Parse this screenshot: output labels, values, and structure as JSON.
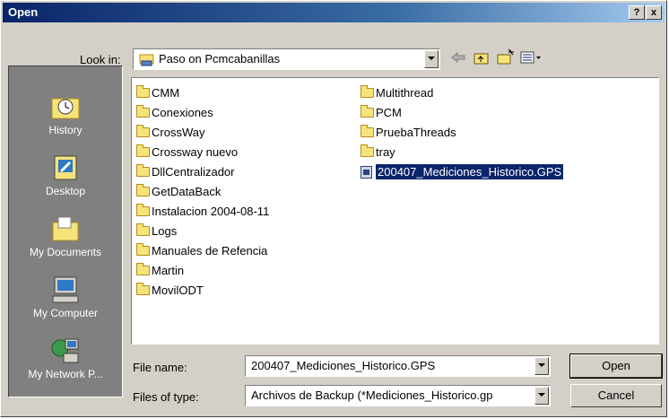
{
  "window": {
    "title": "Open",
    "help_label": "?",
    "close_label": "x"
  },
  "look_in": {
    "label": "Look in:",
    "value": "Paso on Pcmcabanillas"
  },
  "places": [
    {
      "label": "History",
      "icon": "history-icon"
    },
    {
      "label": "Desktop",
      "icon": "desktop-icon"
    },
    {
      "label": "My Documents",
      "icon": "my-documents-icon"
    },
    {
      "label": "My Computer",
      "icon": "my-computer-icon"
    },
    {
      "label": "My Network P...",
      "icon": "my-network-places-icon"
    }
  ],
  "files": {
    "col1": [
      "CMM",
      "Conexiones",
      "CrossWay",
      "Crossway nuevo",
      "DllCentralizador",
      "GetDataBack",
      "Instalacion 2004-08-11",
      "Logs",
      "Manuales de Refencia",
      "Martin",
      "MovilODT"
    ],
    "col2": [
      "Multithread",
      "PCM",
      "PruebaThreads",
      "tray"
    ],
    "selected_file": "200407_Mediciones_Historico.GPS"
  },
  "file_name": {
    "label": "File name:",
    "value": "200407_Mediciones_Historico.GPS"
  },
  "file_type": {
    "label": "Files of type:",
    "value": "Archivos de Backup (*Mediciones_Historico.gp"
  },
  "buttons": {
    "open": "Open",
    "cancel": "Cancel"
  },
  "colors": {
    "title_bar": "#0a246a",
    "selection": "#0a246a",
    "dialog_bg": "#d4d0c8",
    "places_bg": "#808080"
  }
}
